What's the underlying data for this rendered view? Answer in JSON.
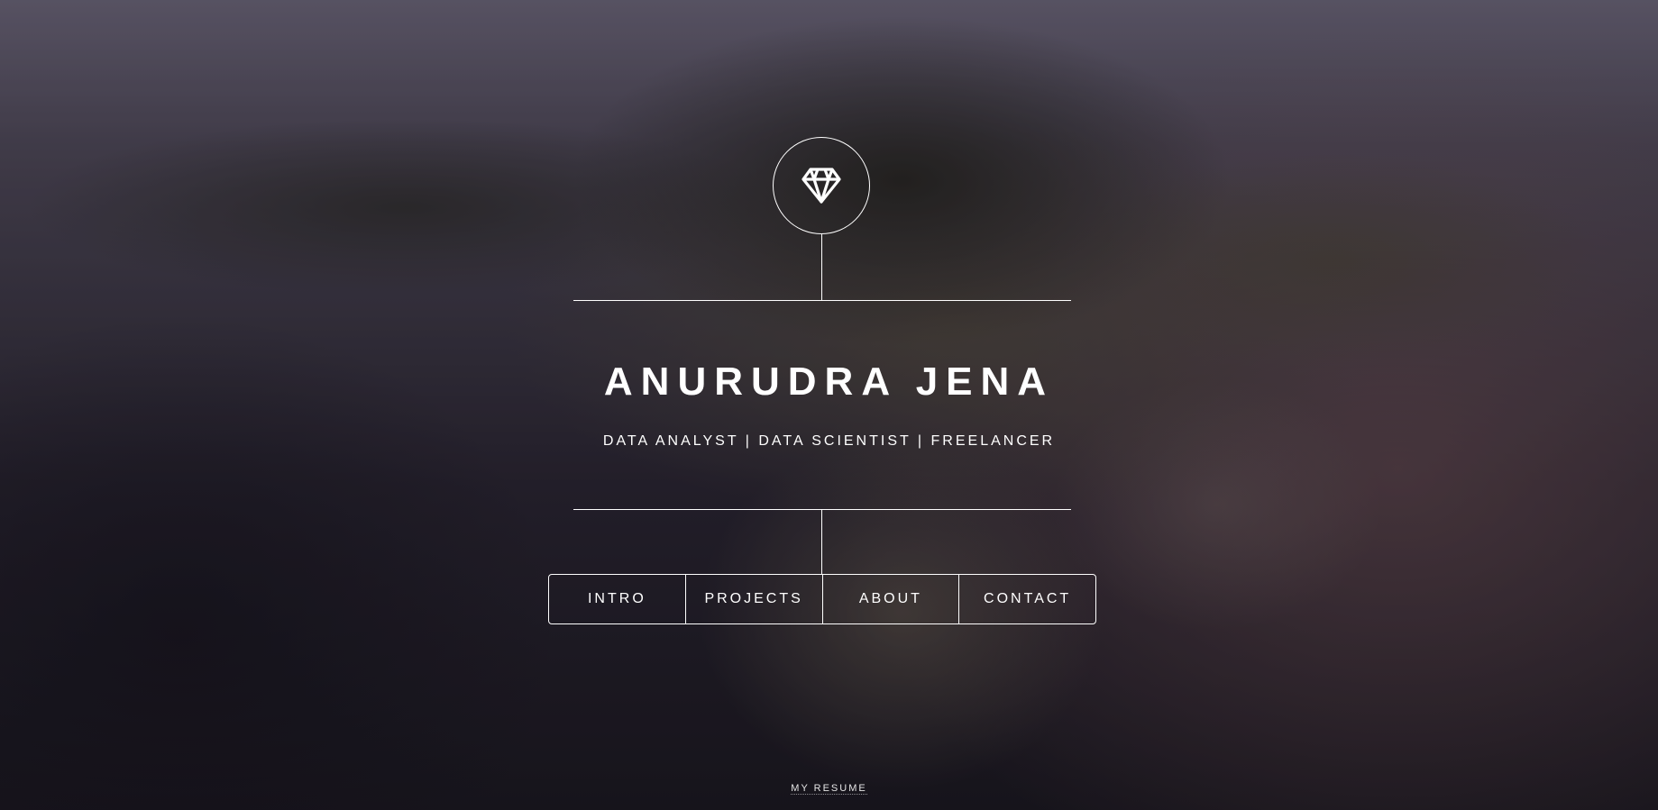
{
  "header": {
    "logo_icon": "diamond-icon",
    "name": "ANURUDRA JENA",
    "subtitle": "DATA ANALYST | DATA SCIENTIST | FREELANCER"
  },
  "nav": {
    "items": [
      {
        "label": "INTRO"
      },
      {
        "label": "PROJECTS"
      },
      {
        "label": "ABOUT"
      },
      {
        "label": "CONTACT"
      }
    ]
  },
  "footer": {
    "resume_label": "MY RESUME"
  },
  "colors": {
    "text": "#ffffff",
    "background": "#2a2631"
  }
}
